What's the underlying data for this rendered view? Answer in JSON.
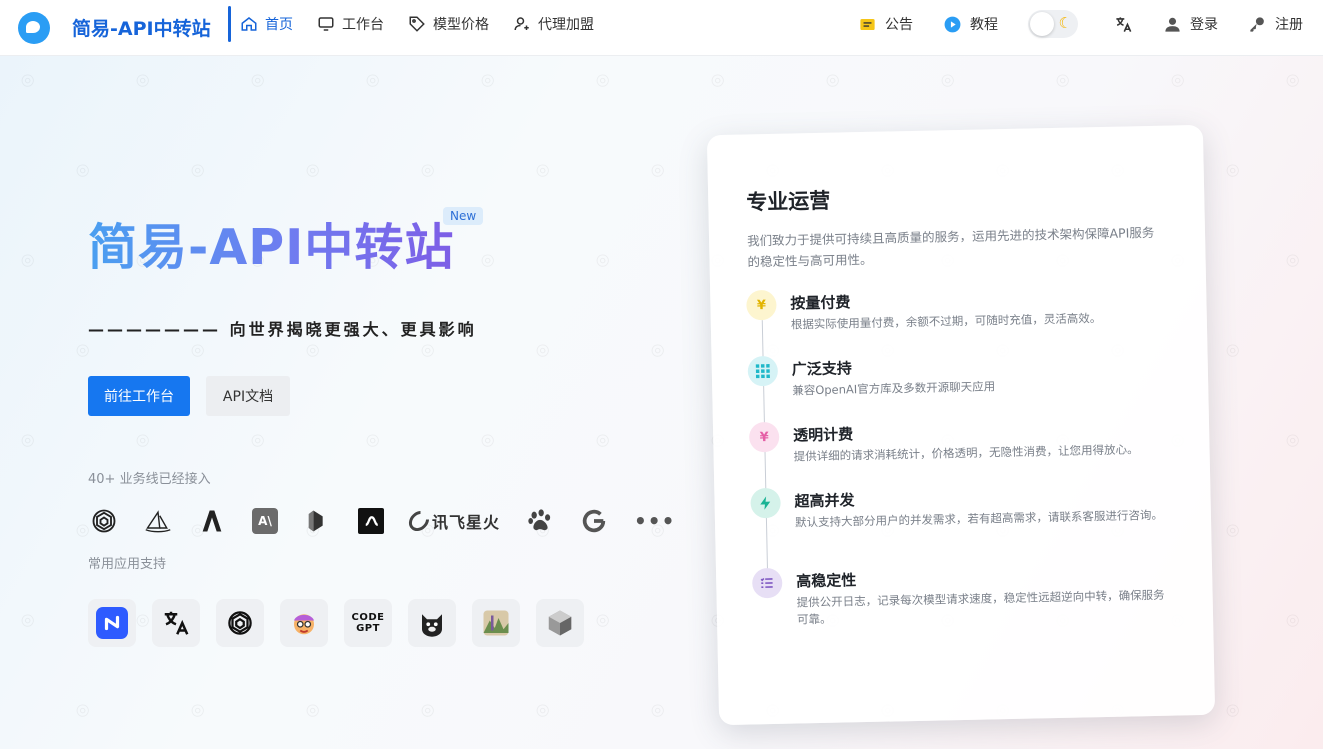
{
  "header": {
    "brand": "简易-API中转站",
    "nav": [
      {
        "label": "首页",
        "icon": "home-icon",
        "active": true
      },
      {
        "label": "工作台",
        "icon": "monitor-icon",
        "active": false
      },
      {
        "label": "模型价格",
        "icon": "tag-icon",
        "active": false
      },
      {
        "label": "代理加盟",
        "icon": "user-add-icon",
        "active": false
      }
    ],
    "right": {
      "notice": "公告",
      "tutorial": "教程",
      "theme_icon": "moon-icon",
      "login": "登录",
      "register": "注册"
    }
  },
  "hero": {
    "title": "简易-API中转站",
    "badge": "New",
    "tagline": "——————— 向世界揭晓更强大、更具影响",
    "btn_primary": "前往工作台",
    "btn_secondary": "API文档",
    "providers_label": "40+ 业务线已经接入",
    "providers": [
      "openai-icon",
      "midjourney-icon",
      "anthropic-icon",
      "claude-icon",
      "deepseek-icon",
      "zhipu-icon",
      "xunfei-icon",
      "baidu-icon",
      "google-icon",
      "more-icon"
    ],
    "xunfei_text": "讯飞星火",
    "more_text": "•••",
    "apps_label": "常用应用支持",
    "apps": [
      "app-n-icon",
      "translate-icon",
      "chatgpt-icon",
      "avatar-app-icon",
      "codegpt-icon",
      "cat-app-icon",
      "landscape-app-icon",
      "cube-app-icon"
    ],
    "codegpt_text": "CODE GPT"
  },
  "card": {
    "title": "专业运营",
    "desc": "我们致力于提供可持续且高质量的服务，运用先进的技术架构保障API服务的稳定性与高可用性。",
    "features": [
      {
        "title": "按量付费",
        "desc": "根据实际使用量付费，余额不过期，可随时充值，灵活高效。",
        "icon": "coin-icon",
        "color": "#f2c31b",
        "bg": "#fdf5cf"
      },
      {
        "title": "广泛支持",
        "desc": "兼容OpenAI官方库及多数开源聊天应用",
        "icon": "grid-icon",
        "color": "#1fb8c9",
        "bg": "#d6f3f6"
      },
      {
        "title": "透明计费",
        "desc": "提供详细的请求消耗统计，价格透明，无隐性消费，让您用得放心。",
        "icon": "yen-icon",
        "color": "#e55fa6",
        "bg": "#fbe1ef"
      },
      {
        "title": "超高并发",
        "desc": "默认支持大部分用户的并发需求，若有超高需求，请联系客服进行咨询。",
        "icon": "bolt-icon",
        "color": "#1ab394",
        "bg": "#d5f2ea"
      },
      {
        "title": "高稳定性",
        "desc": "提供公开日志，记录每次模型请求速度，稳定性远超逆向中转，确保服务可靠。",
        "icon": "list-icon",
        "color": "#7e57c2",
        "bg": "#e7dff5"
      }
    ]
  },
  "colors": {
    "accent": "#1677f0",
    "brand": "#1664d9"
  }
}
